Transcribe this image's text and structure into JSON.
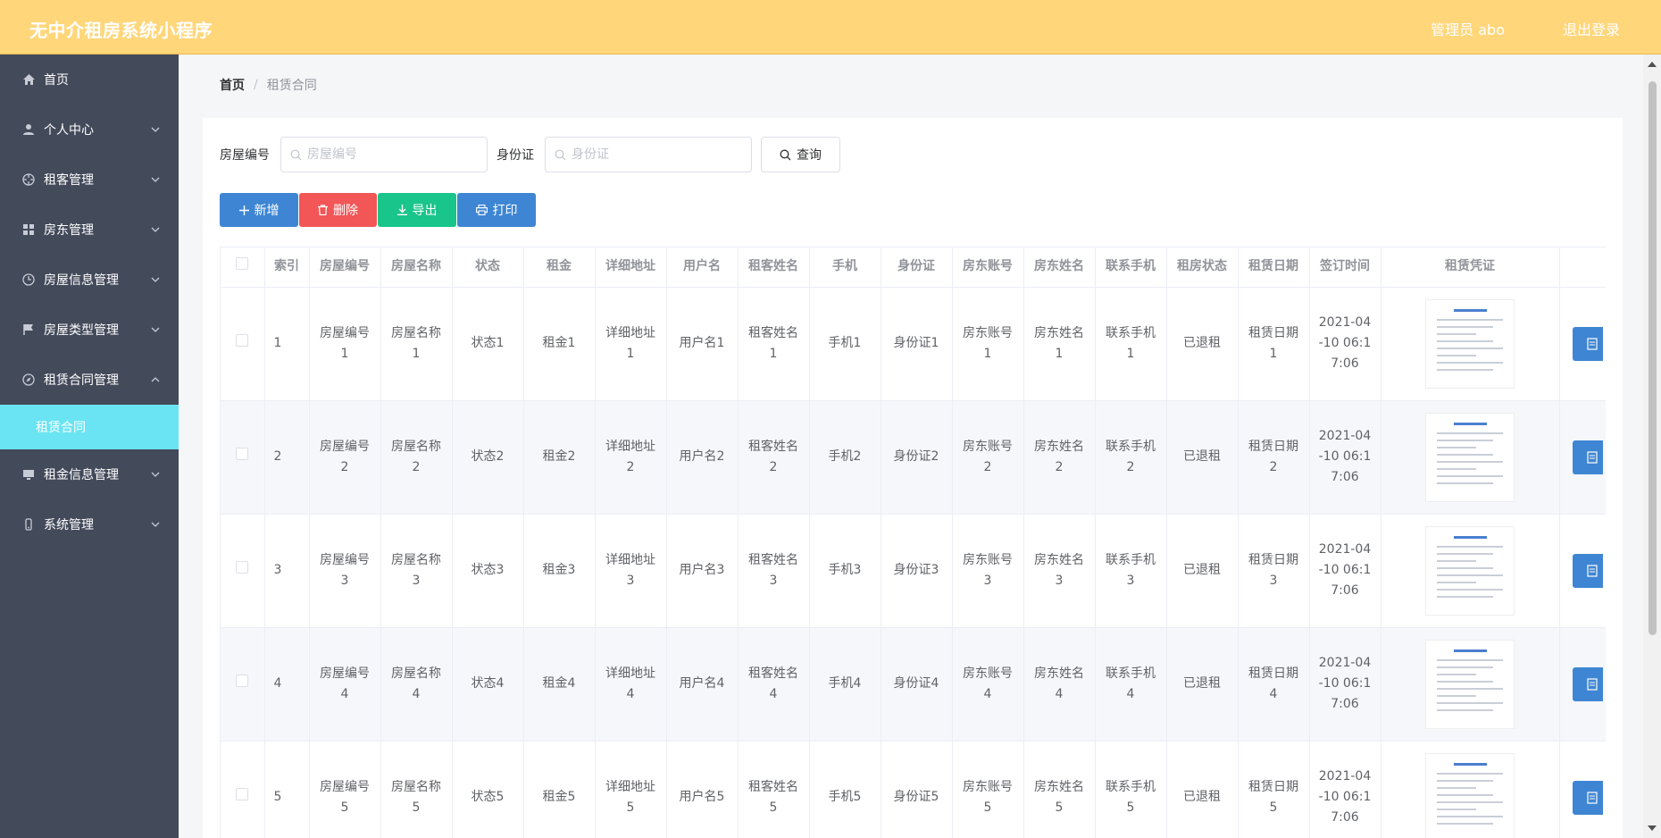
{
  "header": {
    "title": "无中介租房系统小程序",
    "admin": "管理员 abo",
    "logout": "退出登录"
  },
  "sidebar": {
    "items": [
      {
        "label": "首页",
        "icon": "home-icon",
        "expandable": false
      },
      {
        "label": "个人中心",
        "icon": "user-icon",
        "expandable": true
      },
      {
        "label": "租客管理",
        "icon": "target-icon",
        "expandable": true
      },
      {
        "label": "房东管理",
        "icon": "grid-icon",
        "expandable": true
      },
      {
        "label": "房屋信息管理",
        "icon": "clock-icon",
        "expandable": true
      },
      {
        "label": "房屋类型管理",
        "icon": "flag-icon",
        "expandable": true
      },
      {
        "label": "租赁合同管理",
        "icon": "compass-icon",
        "expandable": true,
        "expanded": true
      },
      {
        "label": "租金信息管理",
        "icon": "monitor-icon",
        "expandable": true
      },
      {
        "label": "系统管理",
        "icon": "phone-icon",
        "expandable": true
      }
    ],
    "sub_active": "租赁合同"
  },
  "breadcrumb": {
    "home": "首页",
    "separator": "/",
    "current": "租赁合同"
  },
  "search": {
    "house_no_label": "房屋编号",
    "house_no_placeholder": "房屋编号",
    "id_label": "身份证",
    "id_placeholder": "身份证",
    "query_button": "查询"
  },
  "actions": {
    "add": "新增",
    "delete": "删除",
    "export": "导出",
    "print": "打印",
    "colors": {
      "add": "#3e86d3",
      "delete": "#f25656",
      "export": "#19c58a",
      "print": "#3e86d3"
    }
  },
  "table": {
    "columns": [
      "索引",
      "房屋编号",
      "房屋名称",
      "状态",
      "租金",
      "详细地址",
      "用户名",
      "租客姓名",
      "手机",
      "身份证",
      "房东账号",
      "房东姓名",
      "联系手机",
      "租房状态",
      "租赁日期",
      "签订时间",
      "租赁凭证"
    ],
    "rows": [
      [
        "1",
        "房屋编号1",
        "房屋名称1",
        "状态1",
        "租金1",
        "详细地址1",
        "用户名1",
        "租客姓名1",
        "手机1",
        "身份证1",
        "房东账号1",
        "房东姓名1",
        "联系手机1",
        "已退租",
        "租赁日期1",
        "2021-04-10 06:17:06"
      ],
      [
        "2",
        "房屋编号2",
        "房屋名称2",
        "状态2",
        "租金2",
        "详细地址2",
        "用户名2",
        "租客姓名2",
        "手机2",
        "身份证2",
        "房东账号2",
        "房东姓名2",
        "联系手机2",
        "已退租",
        "租赁日期2",
        "2021-04-10 06:17:06"
      ],
      [
        "3",
        "房屋编号3",
        "房屋名称3",
        "状态3",
        "租金3",
        "详细地址3",
        "用户名3",
        "租客姓名3",
        "手机3",
        "身份证3",
        "房东账号3",
        "房东姓名3",
        "联系手机3",
        "已退租",
        "租赁日期3",
        "2021-04-10 06:17:06"
      ],
      [
        "4",
        "房屋编号4",
        "房屋名称4",
        "状态4",
        "租金4",
        "详细地址4",
        "用户名4",
        "租客姓名4",
        "手机4",
        "身份证4",
        "房东账号4",
        "房东姓名4",
        "联系手机4",
        "已退租",
        "租赁日期4",
        "2021-04-10 06:17:06"
      ],
      [
        "5",
        "房屋编号5",
        "房屋名称5",
        "状态5",
        "租金5",
        "详细地址5",
        "用户名5",
        "租客姓名5",
        "手机5",
        "身份证5",
        "房东账号5",
        "房东姓名5",
        "联系手机5",
        "已退租",
        "租赁日期5",
        "2021-04-10 06:17:06"
      ]
    ]
  },
  "colors": {
    "header": "#ffd67a",
    "sidebar": "#434a5a",
    "submenu_active": "#6ae4f3"
  }
}
